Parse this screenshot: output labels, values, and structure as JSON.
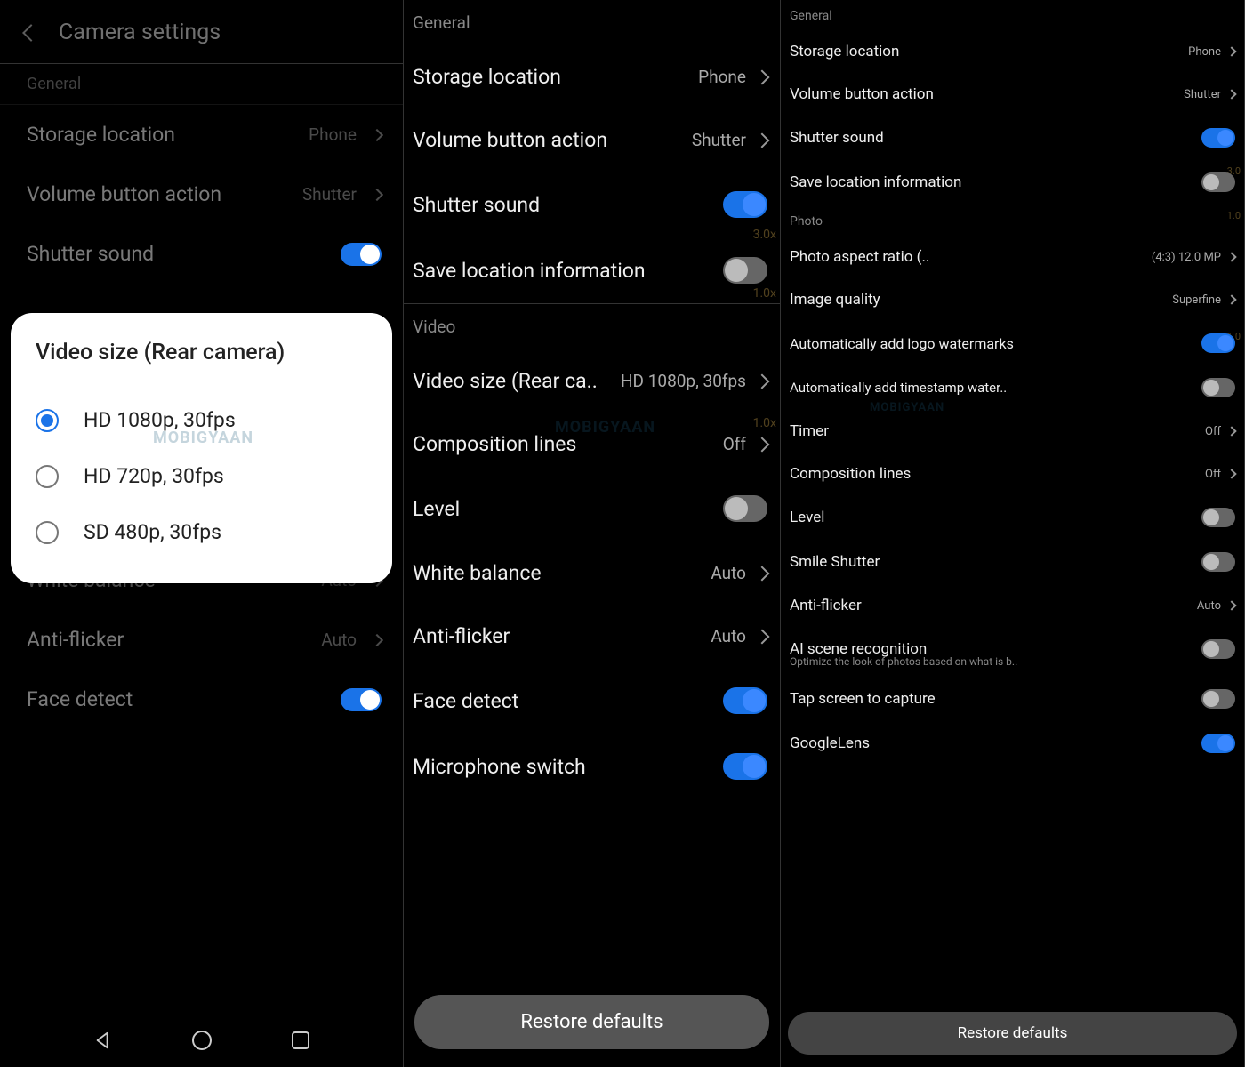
{
  "panel1": {
    "title": "Camera settings",
    "section_general": "General",
    "storage_location": {
      "label": "Storage location",
      "value": "Phone"
    },
    "volume_button": {
      "label": "Volume button action",
      "value": "Shutter"
    },
    "shutter_sound": {
      "label": "Shutter sound",
      "on": true
    },
    "white_balance": {
      "label": "White balance",
      "value": "Auto"
    },
    "anti_flicker": {
      "label": "Anti-flicker",
      "value": "Auto"
    },
    "face_detect": {
      "label": "Face detect",
      "on": true
    },
    "modal": {
      "title": "Video size (Rear camera)",
      "options": [
        "HD 1080p, 30fps",
        "HD 720p, 30fps",
        "SD 480p, 30fps"
      ],
      "selected": 0
    },
    "watermark": "MOBIGYAAN"
  },
  "panel2": {
    "section_general": "General",
    "storage_location": {
      "label": "Storage location",
      "value": "Phone"
    },
    "volume_button": {
      "label": "Volume button action",
      "value": "Shutter"
    },
    "shutter_sound": {
      "label": "Shutter sound",
      "on": true
    },
    "save_location": {
      "label": "Save location information",
      "on": false
    },
    "section_video": "Video",
    "video_size": {
      "label": "Video size (Rear ca..",
      "value": "HD 1080p, 30fps"
    },
    "composition": {
      "label": "Composition lines",
      "value": "Off"
    },
    "level": {
      "label": "Level",
      "on": false
    },
    "white_balance": {
      "label": "White balance",
      "value": "Auto"
    },
    "anti_flicker": {
      "label": "Anti-flicker",
      "value": "Auto"
    },
    "face_detect": {
      "label": "Face detect",
      "on": true
    },
    "microphone": {
      "label": "Microphone switch",
      "on": true
    },
    "restore": "Restore defaults",
    "zoom_hints": [
      "3.0x",
      "1.0x",
      "1.0x"
    ],
    "watermark": "MOBIGYAAN"
  },
  "panel3": {
    "section_general": "General",
    "storage_location": {
      "label": "Storage location",
      "value": "Phone"
    },
    "volume_button": {
      "label": "Volume button action",
      "value": "Shutter"
    },
    "shutter_sound": {
      "label": "Shutter sound",
      "on": true
    },
    "save_location": {
      "label": "Save location information",
      "on": false
    },
    "section_photo": "Photo",
    "aspect_ratio": {
      "label": "Photo aspect ratio (..",
      "value": "(4:3) 12.0 MP"
    },
    "image_quality": {
      "label": "Image quality",
      "value": "Superfine"
    },
    "logo_watermark": {
      "label": "Automatically add logo watermarks",
      "on": true
    },
    "timestamp_watermark": {
      "label": "Automatically add timestamp water..",
      "on": false
    },
    "timer": {
      "label": "Timer",
      "value": "Off"
    },
    "composition": {
      "label": "Composition lines",
      "value": "Off"
    },
    "level": {
      "label": "Level",
      "on": false
    },
    "smile_shutter": {
      "label": "Smile Shutter",
      "on": false
    },
    "anti_flicker": {
      "label": "Anti-flicker",
      "value": "Auto"
    },
    "ai_scene": {
      "label": "AI scene recognition",
      "on": false,
      "sub": "Optimize the look of photos based on what is b.."
    },
    "tap_capture": {
      "label": "Tap screen to capture",
      "on": false
    },
    "google_lens": {
      "label": "GoogleLens",
      "on": true
    },
    "restore": "Restore defaults",
    "zoom_hints": [
      "3.0",
      "1.0",
      "1.0"
    ],
    "watermark": "MOBIGYAAN"
  }
}
